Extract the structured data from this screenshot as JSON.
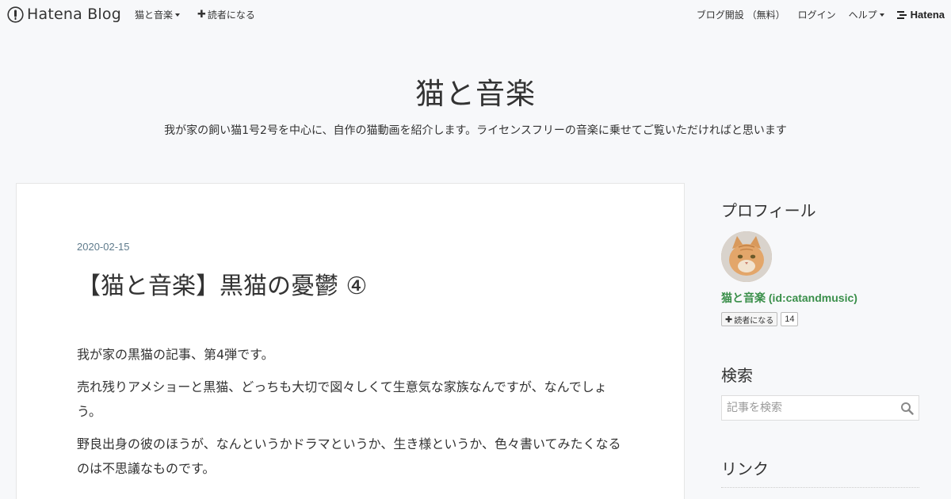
{
  "topbar": {
    "brand": "Hatena Blog",
    "blog_menu": "猫と音楽",
    "subscribe": "読者になる",
    "open_blog": "ブログ開設 （無料）",
    "login": "ログイン",
    "help": "ヘルプ",
    "hatena": "Hatena"
  },
  "header": {
    "title": "猫と音楽",
    "description": "我が家の飼い猫1号2号を中心に、自作の猫動画を紹介します。ライセンスフリーの音楽に乗せてご覧いただければと思います"
  },
  "entry": {
    "date": "2020-02-15",
    "title": "【猫と音楽】黒猫の憂鬱 ④",
    "paragraphs": [
      "我が家の黒猫の記事、第4弾です。",
      "売れ残りアメショーと黒猫、どっちも大切で図々しくて生意気な家族なんですが、なんでしょう。",
      "野良出身の彼のほうが、なんというかドラマというか、生き様というか、色々書いてみたくなるのは不思議なものです。"
    ]
  },
  "sidebar": {
    "profile_title": "プロフィール",
    "profile_name": "猫と音楽 (id:catandmusic)",
    "subscribe_label": "読者になる",
    "subscriber_count": "14",
    "search_title": "検索",
    "search_placeholder": "記事を検索",
    "link_title": "リンク"
  },
  "colors": {
    "background": "#f7f8fa",
    "profile_name": "#3a8f4a",
    "date": "#5f7b8c"
  }
}
